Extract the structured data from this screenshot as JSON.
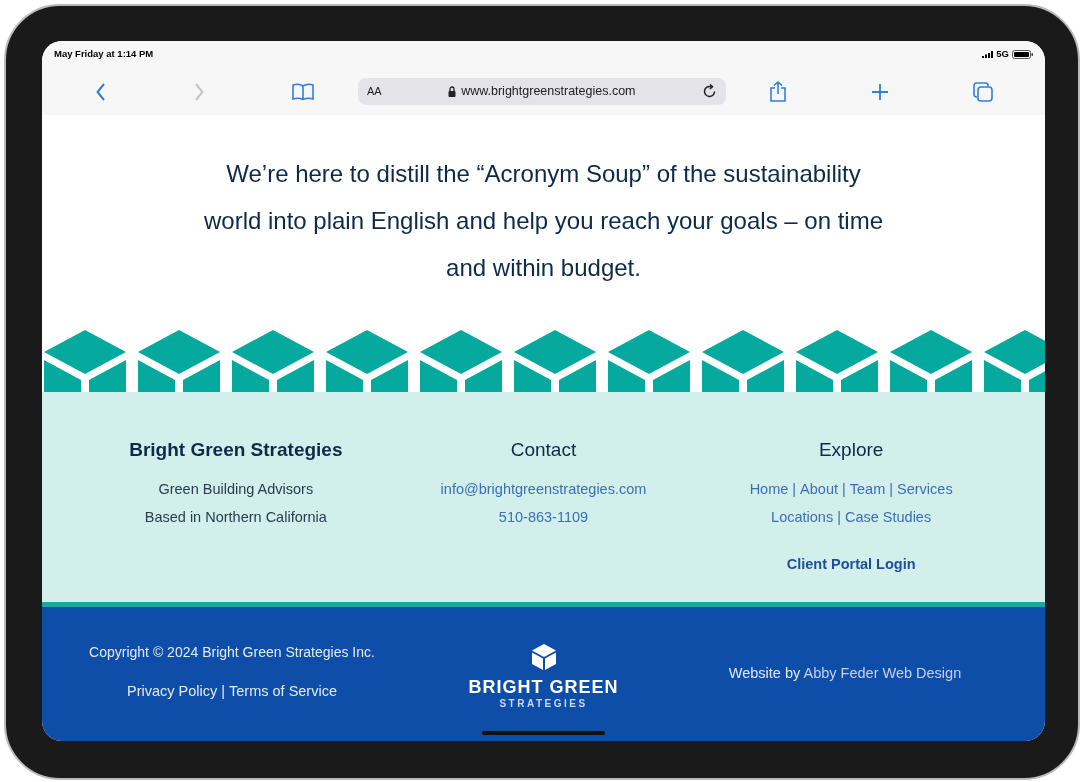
{
  "status_bar": {
    "time": "May Friday at 1:14 PM",
    "network": "5G"
  },
  "browser": {
    "text_size_label": "AA",
    "url": "www.brightgreenstrategies.com",
    "forward_disabled": true
  },
  "intro": {
    "text": "We’re here to distill the “Acronym Soup” of the sustainability world into plain English and help you reach your goals – on time and within budget."
  },
  "footer_columns": [
    {
      "kind": "about",
      "heading": "Bright Green Strategies",
      "lines": [
        "Green Building Advisors",
        "Based in Northern California"
      ]
    },
    {
      "kind": "contact",
      "heading": "Contact",
      "email": "info@brightgreenstrategies.com",
      "phone": "510-863-1109"
    },
    {
      "kind": "explore",
      "heading": "Explore",
      "separator": "|",
      "link_rows": [
        [
          "Home",
          "About",
          "Team",
          "Services"
        ],
        [
          "Locations",
          "Case Studies"
        ]
      ],
      "portal": "Client Portal Login"
    }
  ],
  "bottom_bar": {
    "copyright": "Copyright © 2024 Bright Green Strategies Inc.",
    "separator": "|",
    "legal_links": [
      "Privacy Policy",
      "Terms of Service"
    ],
    "logo_main": "BRIGHT GREEN",
    "logo_sub": "STRATEGIES",
    "credit_prefix": "Website by",
    "credit_link": "Abby Feder Web Design"
  }
}
